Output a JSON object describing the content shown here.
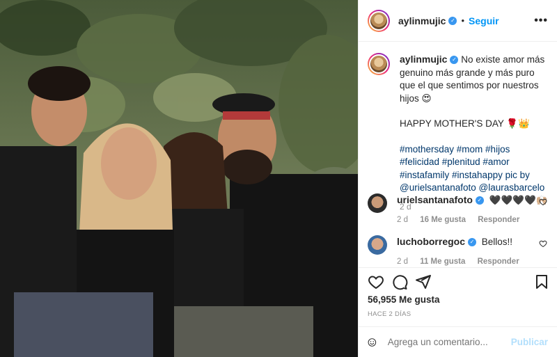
{
  "post": {
    "username": "aylinmujic",
    "follow_label": "Seguir",
    "more_label": "•••",
    "caption": {
      "text": "No existe amor más genuino más grande y más puro que el que sentimos por nuestros hijos 😍",
      "line2": "HAPPY MOTHER'S DAY 🌹👑",
      "hashtags": "#mothersday #mom #hijos #felicidad #plenitud #amor #instafamily #instahappy pic by @urielsantanafoto @laurasbarcelo",
      "time": "2 d"
    },
    "comments": [
      {
        "username": "urielsantanafoto",
        "text": "🖤🖤🖤🖤🙌🏼",
        "time": "2 d",
        "likes": "16 Me gusta",
        "reply": "Responder"
      },
      {
        "username": "luchoborregoc",
        "text": "Bellos!!",
        "time": "2 d",
        "likes": "11 Me gusta",
        "reply": "Responder"
      }
    ],
    "likes_count": "56,955 Me gusta",
    "posted_ago": "HACE 2 DÍAS",
    "composer": {
      "placeholder": "Agrega un comentario...",
      "post_label": "Publicar"
    }
  },
  "colors": {
    "link_blue": "#0095f6",
    "hashtag": "#00376b",
    "muted": "#8e8e8e",
    "post_disabled": "#b2dffc"
  },
  "icons": [
    "heart-icon",
    "comment-icon",
    "share-icon",
    "bookmark-icon",
    "emoji-icon",
    "verified-icon"
  ]
}
